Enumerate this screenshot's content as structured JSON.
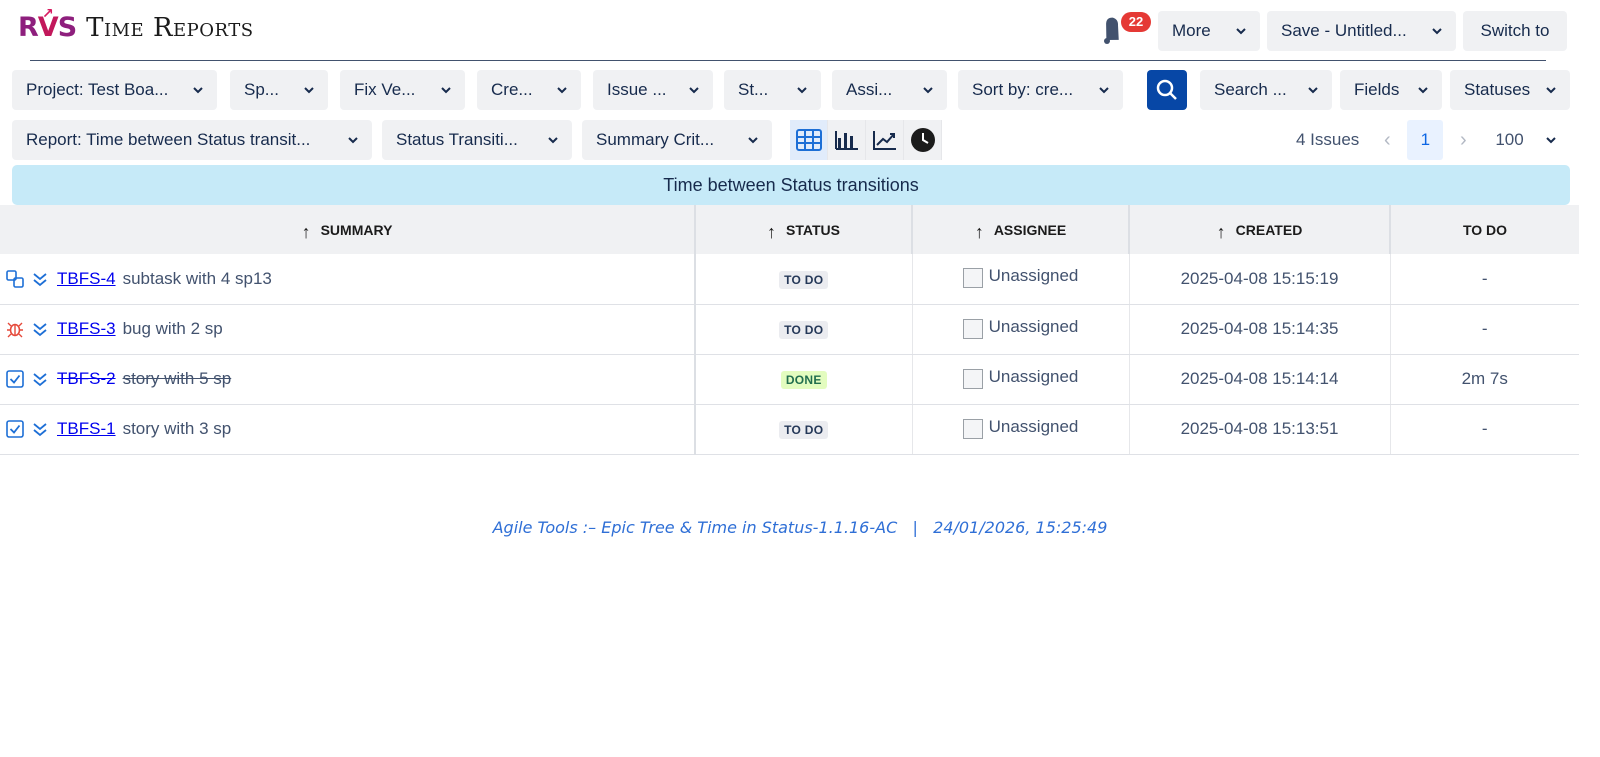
{
  "header": {
    "logo_text_r": "R",
    "logo_text_v": "V",
    "logo_text_s": "S",
    "title": "Time Reports",
    "notification_count": "22",
    "more_label": "More",
    "save_label": "Save - Untitled...",
    "switch_label": "Switch to"
  },
  "filters": {
    "project": "Project: Test Boa...",
    "sprint": "Sp...",
    "fix_version": "Fix Ve...",
    "created": "Cre...",
    "issue_type": "Issue ...",
    "status": "St...",
    "assignee": "Assi...",
    "sort_by": "Sort by: cre...",
    "search": "Search ...",
    "fields": "Fields",
    "statuses": "Statuses"
  },
  "report_bar": {
    "report": "Report: Time between Status transit...",
    "status_transitions": "Status Transiti...",
    "summary_criteria": "Summary Crit...",
    "issue_count": "4 Issues",
    "current_page": "1",
    "page_size": "100"
  },
  "banner": "Time between Status transitions",
  "table": {
    "columns": {
      "summary": "SUMMARY",
      "status": "STATUS",
      "assignee": "ASSIGNEE",
      "created": "CREATED",
      "todo": "TO DO"
    },
    "rows": [
      {
        "type": "subtask",
        "key": "TBFS-4",
        "summary": "subtask with 4 sp13",
        "status": "TO DO",
        "assignee": "Unassigned",
        "created": "2025-04-08 15:15:19",
        "todo": "-"
      },
      {
        "type": "bug",
        "key": "TBFS-3",
        "summary": "bug with 2 sp",
        "status": "TO DO",
        "assignee": "Unassigned",
        "created": "2025-04-08 15:14:35",
        "todo": "-"
      },
      {
        "type": "story",
        "key": "TBFS-2",
        "summary": "story with 5 sp",
        "status": "DONE",
        "assignee": "Unassigned",
        "created": "2025-04-08 15:14:14",
        "todo": "2m 7s"
      },
      {
        "type": "story",
        "key": "TBFS-1",
        "summary": "story with 3 sp",
        "status": "TO DO",
        "assignee": "Unassigned",
        "created": "2025-04-08 15:13:51",
        "todo": "-"
      }
    ]
  },
  "footer": "Agile Tools :– Epic Tree & Time in Status-1.1.16-AC   |   24/01/2026, 15:25:49",
  "colors": {
    "accent": "#0747a6",
    "banner": "#c6eaf8",
    "badge": "#e53935",
    "link": "#0000ee",
    "footer": "#2f6fd6"
  }
}
